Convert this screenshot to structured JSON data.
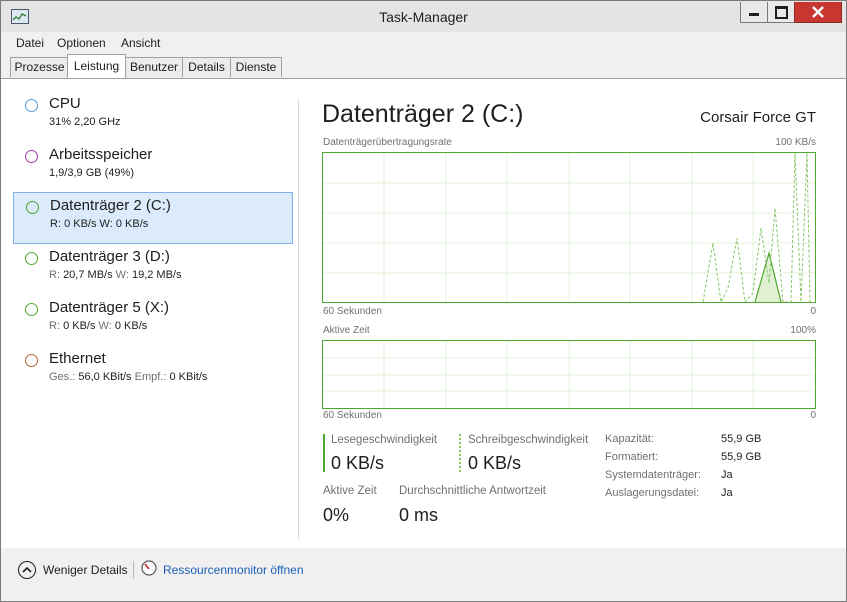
{
  "window": {
    "title": "Task-Manager"
  },
  "menu": [
    "Datei",
    "Optionen",
    "Ansicht"
  ],
  "tabs": [
    "Prozesse",
    "Leistung",
    "Benutzer",
    "Details",
    "Dienste"
  ],
  "active_tab": "Leistung",
  "colors": {
    "cpu": "#5b9bd5",
    "memory": "#a33ca8",
    "disk": "#4ea72e",
    "ethernet": "#b8632a",
    "selected_bg": "#dcebfb"
  },
  "sidebar": [
    {
      "title": "CPU",
      "sub": "31% 2,20 GHz"
    },
    {
      "title": "Arbeitsspeicher",
      "sub": "1,9/3,9 GB (49%)"
    },
    {
      "title": "Datenträger 2 (C:)",
      "sub_r_label": "R:",
      "sub_r": "0 KB/s",
      "sub_w_label": "W:",
      "sub_w": "0 KB/s",
      "selected": true
    },
    {
      "title": "Datenträger 3 (D:)",
      "sub_r_label": "R:",
      "sub_r": "20,7 MB/s",
      "sub_w_label": "W:",
      "sub_w": "19,2 MB/s"
    },
    {
      "title": "Datenträger 5 (X:)",
      "sub_r_label": "R:",
      "sub_r": "0 KB/s",
      "sub_w_label": "W:",
      "sub_w": "0 KB/s"
    },
    {
      "title": "Ethernet",
      "sub_r_label": "Ges.:",
      "sub_r": "56,0 KBit/s",
      "sub_w_label": "Empf.:",
      "sub_w": "0 KBit/s"
    }
  ],
  "detail": {
    "heading": "Datenträger 2 (C:)",
    "device": "Corsair Force GT",
    "graph1": {
      "label": "Datenträgerübertragungsrate",
      "max": "100 KB/s",
      "time": "60 Sekunden",
      "zero": "0"
    },
    "graph2": {
      "label": "Aktive Zeit",
      "max": "100%",
      "time": "60 Sekunden",
      "zero": "0"
    },
    "read_label": "Lesegeschwindigkeit",
    "read_value": "0 KB/s",
    "write_label": "Schreibgeschwindigkeit",
    "write_value": "0 KB/s",
    "active_label": "Aktive Zeit",
    "active_value": "0%",
    "resp_label": "Durchschnittliche Antwortzeit",
    "resp_value": "0 ms",
    "info": [
      {
        "k": "Kapazität:",
        "v": "55,9 GB"
      },
      {
        "k": "Formatiert:",
        "v": "55,9 GB"
      },
      {
        "k": "Systemdatenträger:",
        "v": "Ja"
      },
      {
        "k": "Auslagerungsdatei:",
        "v": "Ja"
      }
    ]
  },
  "footer": {
    "less_details": "Weniger Details",
    "resource_monitor": "Ressourcenmonitor öffnen"
  }
}
